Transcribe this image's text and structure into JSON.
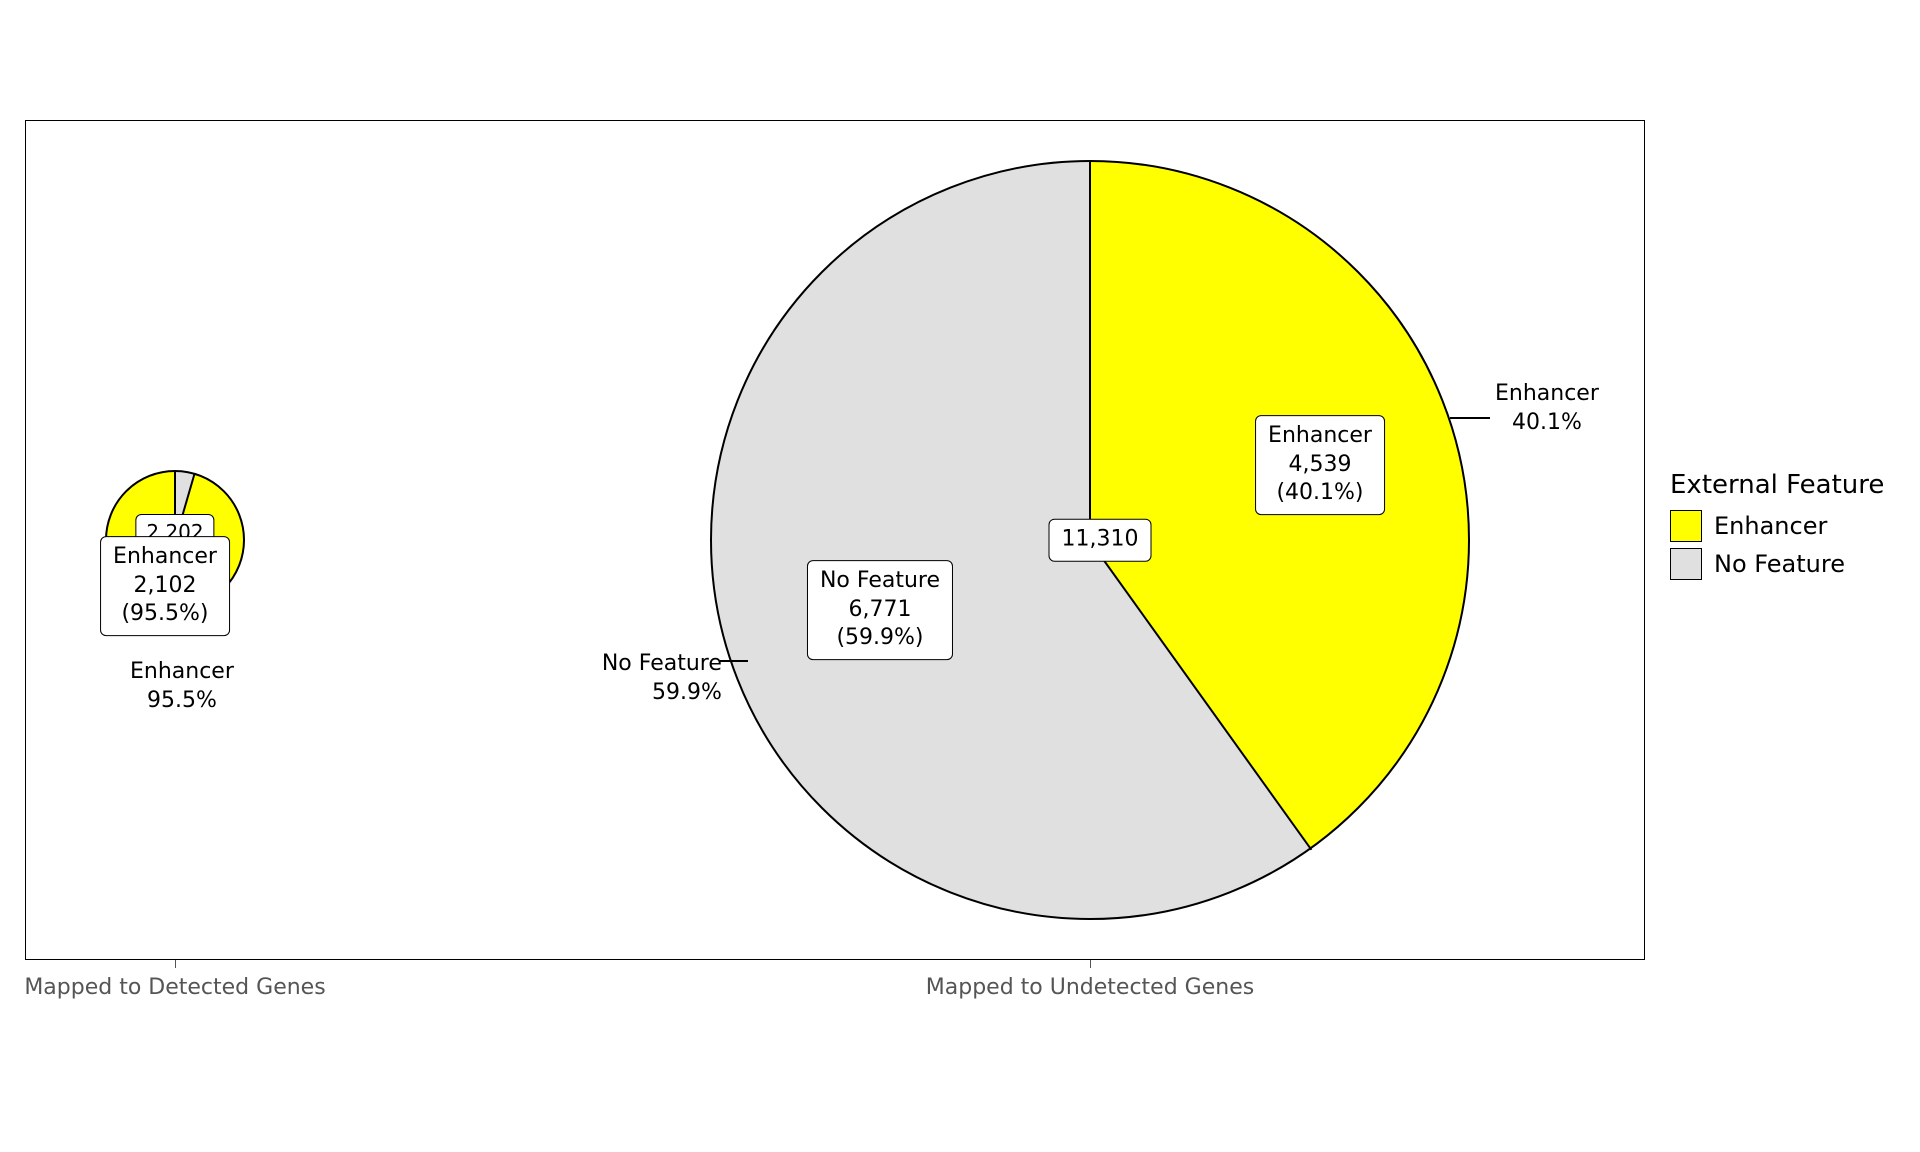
{
  "chart_data": [
    {
      "type": "pie",
      "title": "Mapped to Detected Genes",
      "total": 2202,
      "series": [
        {
          "name": "Enhancer",
          "value": 2102,
          "percent": 95.5,
          "color": "#ffff00"
        },
        {
          "name": "No Feature",
          "value": 100,
          "percent": 4.5,
          "color": "#e0e0e0"
        }
      ]
    },
    {
      "type": "pie",
      "title": "Mapped to Undetected Genes",
      "total": 11310,
      "series": [
        {
          "name": "Enhancer",
          "value": 4539,
          "percent": 40.1,
          "color": "#ffff00"
        },
        {
          "name": "No Feature",
          "value": 6771,
          "percent": 59.9,
          "color": "#e0e0e0"
        }
      ]
    }
  ],
  "legend": {
    "title": "External Feature",
    "items": [
      {
        "label": "Enhancer",
        "color": "#ffff00"
      },
      {
        "label": "No Feature",
        "color": "#e0e0e0"
      }
    ]
  },
  "axis": {
    "left": "Mapped to Detected Genes",
    "right": "Mapped to Undetected Genes"
  },
  "labels": {
    "pie1_center": "2,202",
    "pie1_box_name": "Enhancer",
    "pie1_box_val": "2,102",
    "pie1_box_pct": "(95.5%)",
    "pie1_ext_name": "Enhancer",
    "pie1_ext_pct": "95.5%",
    "pie2_center": "11,310",
    "pie2_enh_name": "Enhancer",
    "pie2_enh_val": "4,539",
    "pie2_enh_pct": "(40.1%)",
    "pie2_nof_name": "No Feature",
    "pie2_nof_val": "6,771",
    "pie2_nof_pct": "(59.9%)",
    "pie2_ext_enh_name": "Enhancer",
    "pie2_ext_enh_pct": "40.1%",
    "pie2_ext_nof_name": "No Feature",
    "pie2_ext_nof_pct": "59.9%"
  }
}
